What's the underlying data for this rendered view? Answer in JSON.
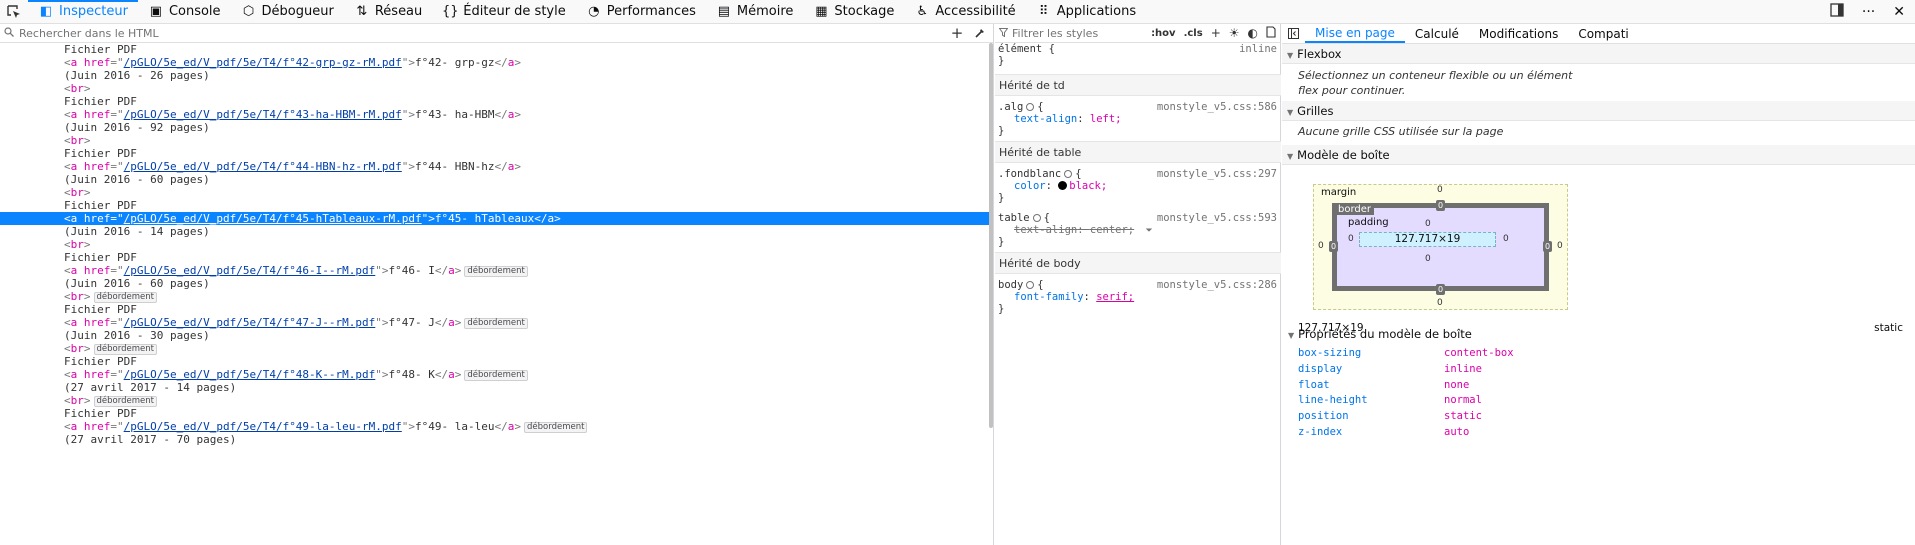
{
  "toolbar": {
    "tabs": [
      {
        "label": "Inspecteur",
        "icon": "inspector-icon"
      },
      {
        "label": "Console",
        "icon": "console-icon"
      },
      {
        "label": "Débogueur",
        "icon": "debugger-icon"
      },
      {
        "label": "Réseau",
        "icon": "network-icon"
      },
      {
        "label": "Éditeur de style",
        "icon": "style-editor-icon"
      },
      {
        "label": "Performances",
        "icon": "performance-icon"
      },
      {
        "label": "Mémoire",
        "icon": "memory-icon"
      },
      {
        "label": "Stockage",
        "icon": "storage-icon"
      },
      {
        "label": "Accessibilité",
        "icon": "accessibility-icon"
      },
      {
        "label": "Applications",
        "icon": "applications-icon"
      }
    ],
    "more_label": "···",
    "close_label": "✕"
  },
  "markup": {
    "search_placeholder": "Rechercher dans le HTML",
    "add_label": "+",
    "selected_index": 15,
    "lines": [
      {
        "indent": 8,
        "kind": "text",
        "text": "Fichier PDF"
      },
      {
        "indent": 8,
        "kind": "a",
        "href": "/pGLO/5e_ed/V_pdf/5e/T4/f°42-grp-gz-rM.pdf",
        "content": "f°42- grp-gz",
        "badge": ""
      },
      {
        "indent": 8,
        "kind": "text",
        "text": "(Juin 2016 - 26 pages)"
      },
      {
        "indent": 8,
        "kind": "br",
        "badge": ""
      },
      {
        "indent": 8,
        "kind": "text",
        "text": "Fichier PDF"
      },
      {
        "indent": 8,
        "kind": "a",
        "href": "/pGLO/5e_ed/V_pdf/5e/T4/f°43-ha-HBM-rM.pdf",
        "content": "f°43- ha-HBM",
        "badge": ""
      },
      {
        "indent": 8,
        "kind": "text",
        "text": "(Juin 2016 - 92 pages)"
      },
      {
        "indent": 8,
        "kind": "br",
        "badge": ""
      },
      {
        "indent": 8,
        "kind": "text",
        "text": "Fichier PDF"
      },
      {
        "indent": 8,
        "kind": "a",
        "href": "/pGLO/5e_ed/V_pdf/5e/T4/f°44-HBN-hz-rM.pdf",
        "content": "f°44- HBN-hz",
        "badge": ""
      },
      {
        "indent": 8,
        "kind": "text",
        "text": "(Juin 2016 - 60 pages)"
      },
      {
        "indent": 8,
        "kind": "br",
        "badge": ""
      },
      {
        "indent": 8,
        "kind": "text",
        "text": "Fichier PDF"
      },
      {
        "indent": 8,
        "kind": "a",
        "href": "/pGLO/5e_ed/V_pdf/5e/T4/f°45-hTableaux-rM.pdf",
        "content": "f°45- hTableaux",
        "badge": ""
      },
      {
        "indent": 8,
        "kind": "text",
        "text": "(Juin 2016 - 14 pages)"
      },
      {
        "indent": 8,
        "kind": "br",
        "badge": ""
      },
      {
        "indent": 8,
        "kind": "text",
        "text": "Fichier PDF"
      },
      {
        "indent": 8,
        "kind": "a",
        "href": "/pGLO/5e_ed/V_pdf/5e/T4/f°46-I--rM.pdf",
        "content": "f°46- I",
        "badge": "débordement"
      },
      {
        "indent": 8,
        "kind": "text",
        "text": "(Juin 2016 - 60 pages)"
      },
      {
        "indent": 8,
        "kind": "br",
        "badge": "débordement"
      },
      {
        "indent": 8,
        "kind": "text",
        "text": "Fichier PDF"
      },
      {
        "indent": 8,
        "kind": "a",
        "href": "/pGLO/5e_ed/V_pdf/5e/T4/f°47-J--rM.pdf",
        "content": "f°47- J",
        "badge": "débordement"
      },
      {
        "indent": 8,
        "kind": "text",
        "text": "(Juin 2016 - 30 pages)"
      },
      {
        "indent": 8,
        "kind": "br",
        "badge": "débordement"
      },
      {
        "indent": 8,
        "kind": "text",
        "text": "Fichier PDF"
      },
      {
        "indent": 8,
        "kind": "a",
        "href": "/pGLO/5e_ed/V_pdf/5e/T4/f°48-K--rM.pdf",
        "content": "f°48- K",
        "badge": "débordement"
      },
      {
        "indent": 8,
        "kind": "text",
        "text": "(27 avril 2017 - 14 pages)"
      },
      {
        "indent": 8,
        "kind": "br",
        "badge": "débordement"
      },
      {
        "indent": 8,
        "kind": "text",
        "text": "Fichier PDF"
      },
      {
        "indent": 8,
        "kind": "a",
        "href": "/pGLO/5e_ed/V_pdf/5e/T4/f°49-la-leu-rM.pdf",
        "content": "f°49- la-leu",
        "badge": "débordement"
      },
      {
        "indent": 8,
        "kind": "text",
        "text": "(27 avril 2017 - 70 pages)"
      }
    ]
  },
  "rules": {
    "filter_placeholder": "Filtrer les styles",
    "hov_label": ":hov",
    "cls_label": ".cls",
    "element_selector": "élément {",
    "element_source": "inline",
    "close_brace": "}",
    "groups": [
      {
        "header": "Hérité de td",
        "selector": ".alg",
        "source": "monstyle_v5.css:586",
        "prop": "text-align",
        "value": "left;",
        "struck": false,
        "swatch": false
      },
      {
        "header": "Hérité de table",
        "selector": ".fondblanc",
        "source": "monstyle_v5.css:297",
        "prop": "color",
        "value": "black;",
        "struck": false,
        "swatch": true
      },
      {
        "header": "",
        "selector": "table",
        "source": "monstyle_v5.css:593",
        "prop": "text-align",
        "value": "center;",
        "struck": true,
        "swatch": false
      },
      {
        "header": "Hérité de body",
        "selector": "body",
        "source": "monstyle_v5.css:286",
        "prop": "font-family",
        "value": "serif;",
        "struck": false,
        "swatch": false
      }
    ]
  },
  "layout": {
    "tabs": [
      "Mise en page",
      "Calculé",
      "Modifications",
      "Compati"
    ],
    "flexbox": {
      "title": "Flexbox",
      "note": "Sélectionnez un conteneur flexible ou un élément flex pour continuer."
    },
    "grid": {
      "title": "Grilles",
      "note": "Aucune grille CSS utilisée sur la page"
    },
    "boxmodel": {
      "title": "Modèle de boîte",
      "margin_label": "margin",
      "border_label": "border",
      "padding_label": "padding",
      "content": "127.717×19",
      "zero": "0"
    },
    "size": "127.717×19",
    "position": "static",
    "props_title": "Propriétés du modèle de boîte",
    "props": [
      {
        "k": "box-sizing",
        "v": "content-box"
      },
      {
        "k": "display",
        "v": "inline"
      },
      {
        "k": "float",
        "v": "none"
      },
      {
        "k": "line-height",
        "v": "normal"
      },
      {
        "k": "position",
        "v": "static"
      },
      {
        "k": "z-index",
        "v": "auto"
      }
    ]
  },
  "colors": {
    "accent": "#0a84ff",
    "tag": "#dd00a9",
    "attr_value": "#003eaa",
    "prop_name": "#0074e8"
  }
}
